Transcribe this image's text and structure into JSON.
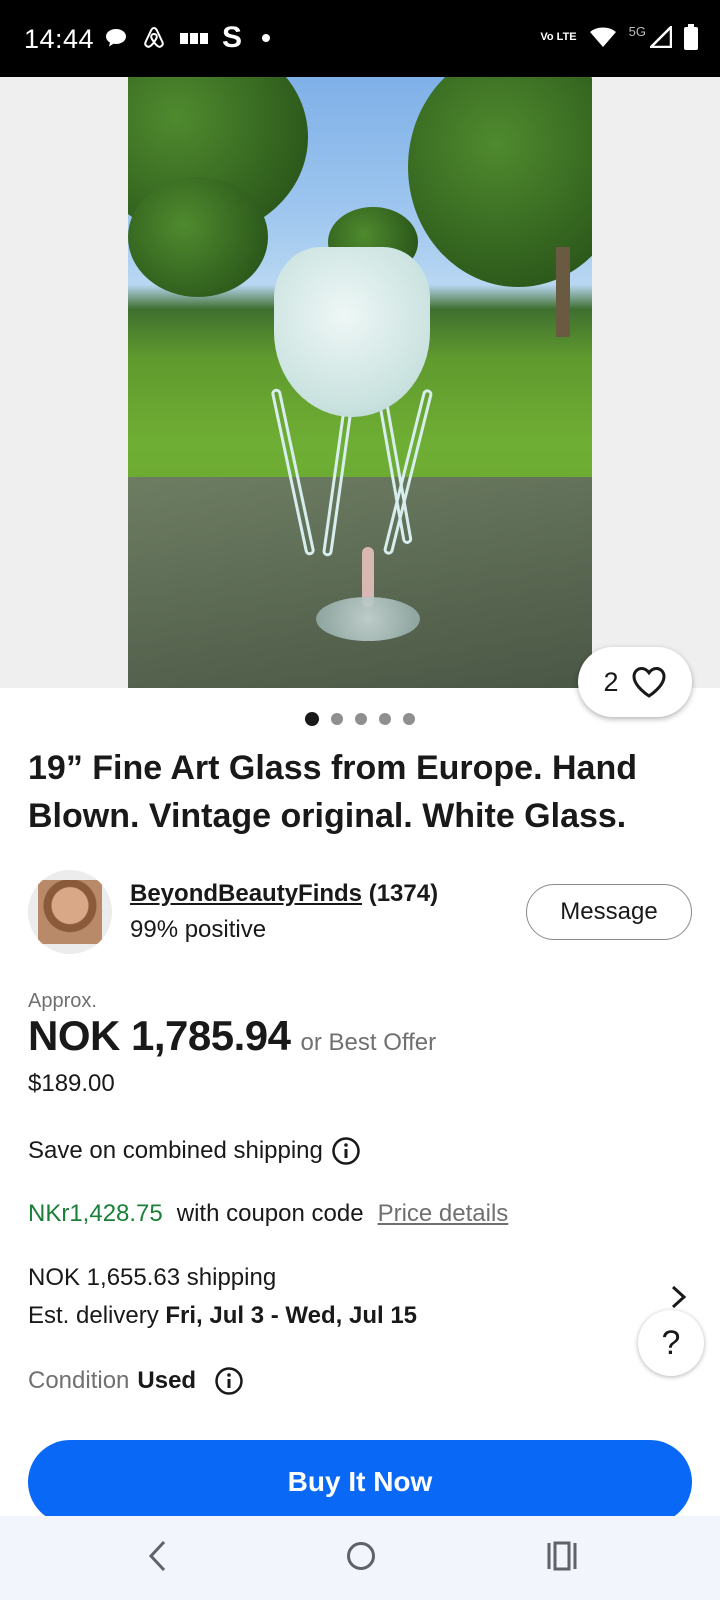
{
  "status_bar": {
    "time": "14:44",
    "network_label": "Vo LTE",
    "network_type": "5G",
    "icons_left": [
      "chat-bubble-icon",
      "airbnb-icon",
      "app-icon",
      "s-app-icon",
      "notification-dot-icon"
    ],
    "icons_right": [
      "volte-icon",
      "wifi-icon",
      "signal-icon",
      "battery-icon"
    ]
  },
  "gallery": {
    "like_count": "2",
    "image_count": 5,
    "active_index": 0
  },
  "listing": {
    "title": "19” Fine Art Glass from Europe. Hand Blown. Vintage original. White Glass."
  },
  "seller": {
    "name": "BeyondBeautyFinds",
    "score": "(1374)",
    "feedback": "99% positive",
    "message_label": "Message"
  },
  "price": {
    "approx_label": "Approx.",
    "amount": "NOK 1,785.94",
    "best_offer": "or Best Offer",
    "original": "$189.00"
  },
  "combined_shipping": {
    "label": "Save on combined shipping"
  },
  "coupon": {
    "price": "NKr1,428.75",
    "text": "with coupon code",
    "details_link": "Price details"
  },
  "shipping": {
    "cost": "NOK 1,655.63 shipping",
    "delivery_label": "Est. delivery",
    "delivery_dates": "Fri, Jul 3 - Wed, Jul 15"
  },
  "help": {
    "label": "?"
  },
  "condition": {
    "label": "Condition",
    "value": "Used"
  },
  "actions": {
    "buy_now": "Buy It Now"
  },
  "colors": {
    "primary_blue": "#0968f6",
    "coupon_green": "#1a7f37",
    "secondary_text": "#707070",
    "text": "#191919"
  }
}
